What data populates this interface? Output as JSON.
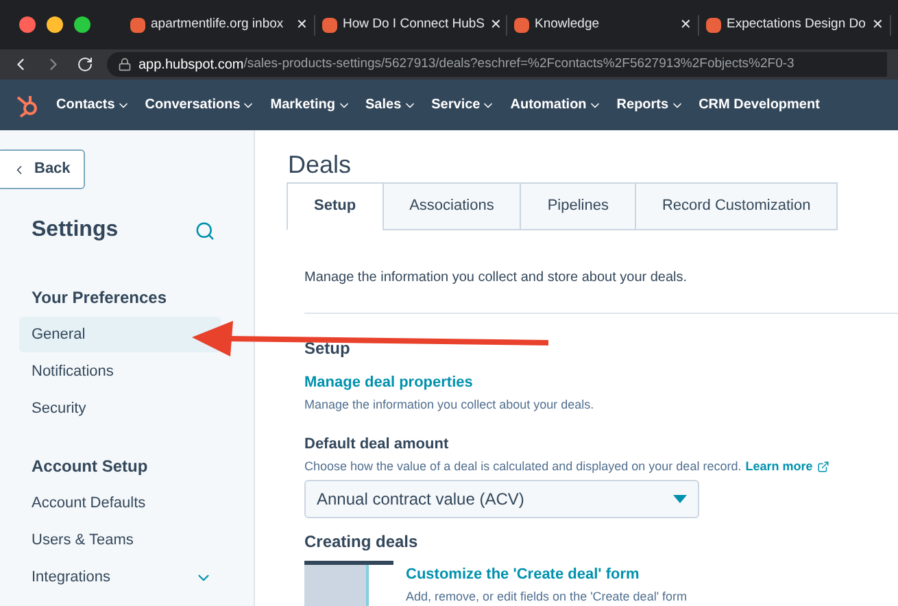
{
  "browser": {
    "tabs": [
      {
        "title": "apartmentlife.org inbox",
        "close": "✕"
      },
      {
        "title": "How Do I Connect HubS",
        "close": "✕"
      },
      {
        "title": "Knowledge",
        "close": "✕"
      },
      {
        "title": "Expectations Design Do",
        "close": "✕"
      }
    ],
    "url_host": "app.hubspot.com",
    "url_path": "/sales-products-settings/5627913/deals?eschref=%2Fcontacts%2F5627913%2Fobjects%2F0-3"
  },
  "nav": {
    "items": [
      {
        "label": "Contacts",
        "dropdown": true
      },
      {
        "label": "Conversations",
        "dropdown": true
      },
      {
        "label": "Marketing",
        "dropdown": true
      },
      {
        "label": "Sales",
        "dropdown": true
      },
      {
        "label": "Service",
        "dropdown": true
      },
      {
        "label": "Automation",
        "dropdown": true
      },
      {
        "label": "Reports",
        "dropdown": true
      },
      {
        "label": "CRM Development",
        "dropdown": false
      }
    ]
  },
  "sidebar": {
    "back": "Back",
    "title": "Settings",
    "sections": [
      {
        "heading": "Your Preferences",
        "items": [
          {
            "label": "General",
            "selected": true,
            "expandable": false
          },
          {
            "label": "Notifications",
            "selected": false,
            "expandable": false
          },
          {
            "label": "Security",
            "selected": false,
            "expandable": false
          }
        ]
      },
      {
        "heading": "Account Setup",
        "items": [
          {
            "label": "Account Defaults",
            "selected": false,
            "expandable": false
          },
          {
            "label": "Users & Teams",
            "selected": false,
            "expandable": false
          },
          {
            "label": "Integrations",
            "selected": false,
            "expandable": true
          }
        ]
      }
    ]
  },
  "main": {
    "title": "Deals",
    "tabs": [
      {
        "label": "Setup",
        "selected": true
      },
      {
        "label": "Associations",
        "selected": false
      },
      {
        "label": "Pipelines",
        "selected": false
      },
      {
        "label": "Record Customization",
        "selected": false
      }
    ],
    "intro": "Manage the information you collect and store about your deals.",
    "setup": {
      "heading": "Setup",
      "link": "Manage deal properties",
      "link_desc": "Manage the information you collect about your deals."
    },
    "default_amount": {
      "label": "Default deal amount",
      "desc": "Choose how the value of a deal is calculated and displayed on your deal record.",
      "learn_more": "Learn more",
      "value": "Annual contract value (ACV)"
    },
    "creating": {
      "heading": "Creating deals",
      "link": "Customize the 'Create deal' form",
      "desc": "Add, remove, or edit fields on the 'Create deal' form"
    }
  }
}
